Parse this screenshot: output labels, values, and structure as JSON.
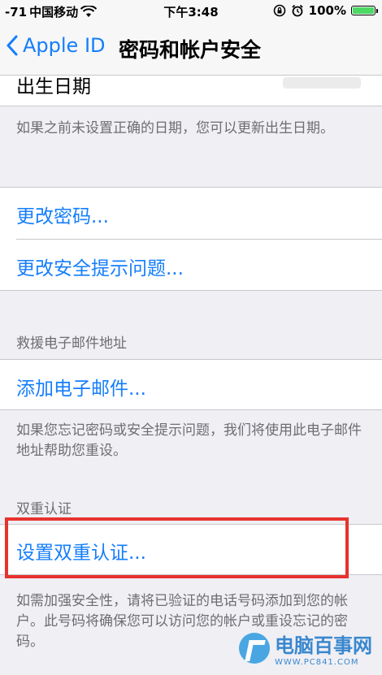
{
  "status_bar": {
    "signal": "-71",
    "carrier": "中国移动",
    "time": "下午3:48",
    "battery": "100%",
    "battery_level": 1.0
  },
  "nav": {
    "back_label": "Apple ID",
    "title": "密码和帐户安全"
  },
  "birthday": {
    "label": "出生日期",
    "footer": "如果之前未设置正确的日期，您可以更新出生日期。"
  },
  "password": {
    "change_password": "更改密码...",
    "change_security_questions": "更改安全提示问题..."
  },
  "rescue_email": {
    "header": "救援电子邮件地址",
    "add_email": "添加电子邮件...",
    "footer": "如果您忘记密码或安全提示问题，我们将使用此电子邮件地址帮助您重设。"
  },
  "two_factor": {
    "header": "双重认证",
    "setup": "设置双重认证...",
    "footer": "如需加强安全性，请将已验证的电话号码添加到您的帐户。此号码将确保您可以访问您的帐户或重设忘记的密码。"
  },
  "watermark": {
    "name": "电脑百事网",
    "url": "WWW.PC841.COM"
  },
  "colors": {
    "accent": "#157efb",
    "highlight": "#e8322e",
    "background": "#efeff4"
  }
}
